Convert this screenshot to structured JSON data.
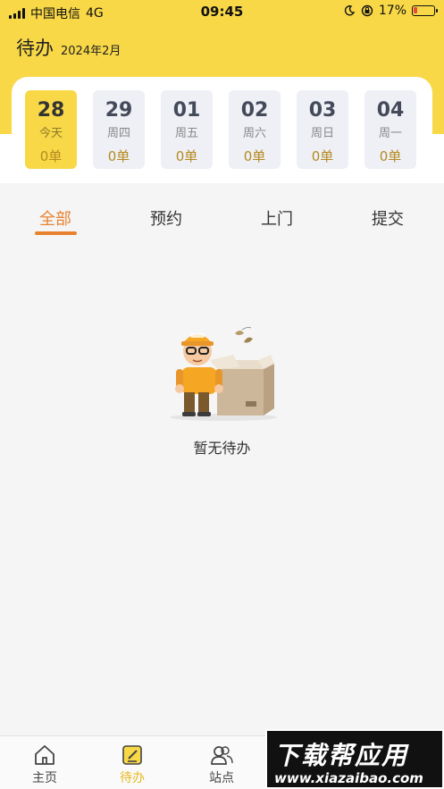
{
  "status_bar": {
    "carrier": "中国电信",
    "network": "4G",
    "time": "09:45",
    "battery": "17%",
    "battery_level": 0.17
  },
  "header": {
    "title": "待办",
    "subtitle": "2024年2月"
  },
  "dates": [
    {
      "day": "28",
      "week": "今天",
      "count": "0单",
      "active": true
    },
    {
      "day": "29",
      "week": "周四",
      "count": "0单",
      "active": false
    },
    {
      "day": "01",
      "week": "周五",
      "count": "0单",
      "active": false
    },
    {
      "day": "02",
      "week": "周六",
      "count": "0单",
      "active": false
    },
    {
      "day": "03",
      "week": "周日",
      "count": "0单",
      "active": false
    },
    {
      "day": "04",
      "week": "周一",
      "count": "0单",
      "active": false
    }
  ],
  "tabs": [
    {
      "label": "全部",
      "active": true
    },
    {
      "label": "预约",
      "active": false
    },
    {
      "label": "上门",
      "active": false
    },
    {
      "label": "提交",
      "active": false
    }
  ],
  "empty_state": {
    "message": "暂无待办",
    "illustration": "courier-with-box-illustration"
  },
  "bottom_nav": [
    {
      "label": "主页",
      "icon": "home-icon",
      "active": false
    },
    {
      "label": "待办",
      "icon": "todo-icon",
      "active": true
    },
    {
      "label": "站点",
      "icon": "people-icon",
      "active": false
    }
  ],
  "watermark": {
    "title": "下载帮应用",
    "url": "www.xiazaibao.com"
  },
  "colors": {
    "brand_yellow": "#f8d847",
    "accent_orange": "#e8822e",
    "count_gold": "#b58a1e"
  }
}
